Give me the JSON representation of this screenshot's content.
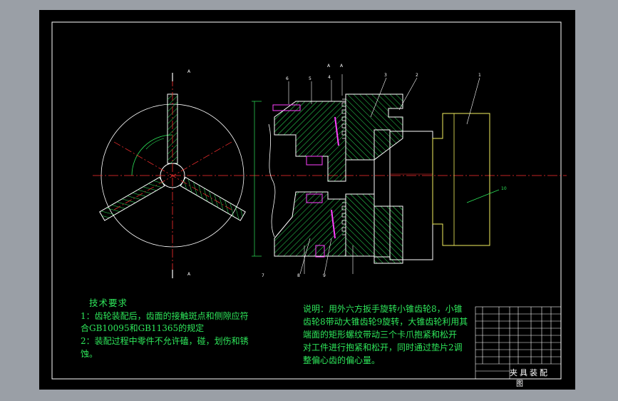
{
  "drawing": {
    "tech_requirements": {
      "title": "技术要求",
      "lines": [
        "1：齿轮装配后，齿面的接触斑点和侧隙应符",
        "合GB10095和GB11365的规定",
        "2：装配过程中零件不允许磕，碰，划伤和锈",
        "蚀。"
      ]
    },
    "description": {
      "lines": [
        "说明：用外六方扳手旋转小锥齿轮8，小锥",
        "齿轮8带动大锥齿轮9旋转，大锥齿轮利用其",
        "端面的矩形螺纹带动三个卡爪抱紧和松开",
        "对工件进行抱紧和松开，同时通过垫片2调",
        "整偏心齿的偏心量。"
      ]
    },
    "title_block": {
      "name": "夹具装配",
      "name_suffix": "图"
    },
    "callouts": [
      "1",
      "2",
      "3",
      "4",
      "5",
      "6",
      "7",
      "8",
      "9",
      "10"
    ],
    "section_marks": [
      "A",
      "A",
      "A",
      "A"
    ],
    "colors": {
      "background": "#000000",
      "frame": "#ffffff",
      "centerline": "#ff3030",
      "part": "#2ee65a",
      "body": "#ffffff",
      "chuck": "#f5f060",
      "bolt": "#ff40ff",
      "window_bg": "#9a9fa6"
    }
  }
}
